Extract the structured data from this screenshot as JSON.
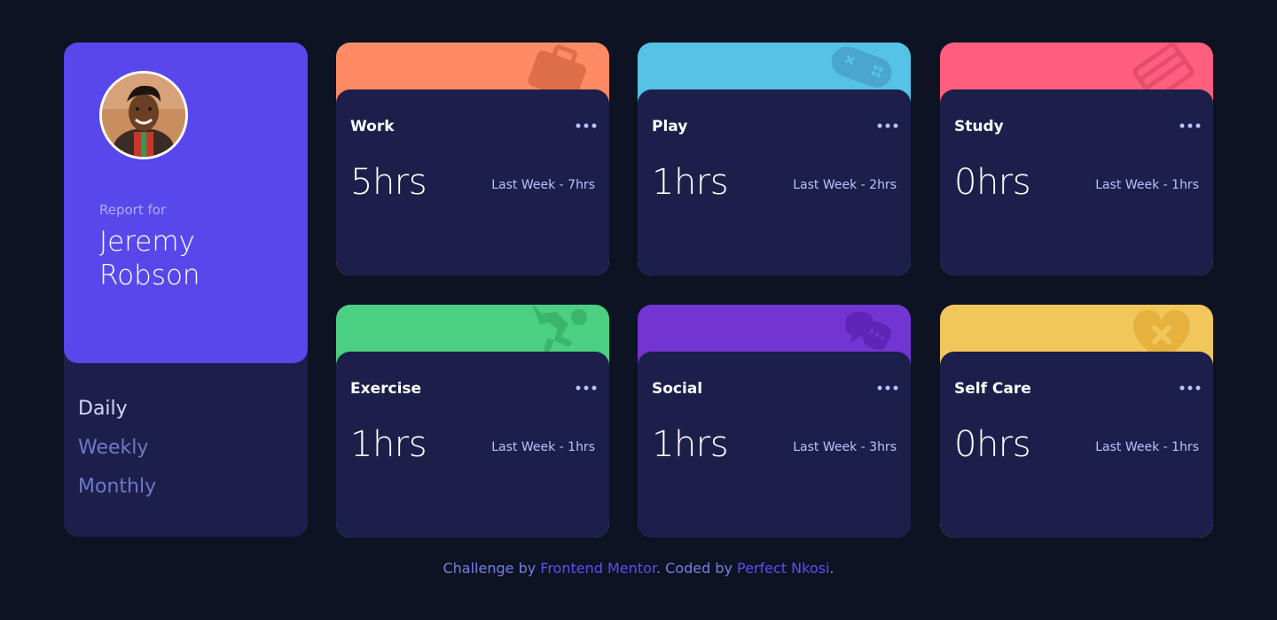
{
  "profile": {
    "report_label": "Report for",
    "name": "Jeremy Robson",
    "avatar_alt": "avatar"
  },
  "periods": [
    {
      "label": "Daily",
      "active": true
    },
    {
      "label": "Weekly",
      "active": false
    },
    {
      "label": "Monthly",
      "active": false
    }
  ],
  "cards": [
    {
      "title": "Work",
      "hours": "5hrs",
      "last_week": "Last Week - 7hrs",
      "color": "#ff8b64",
      "icon": "briefcase-icon"
    },
    {
      "title": "Play",
      "hours": "1hrs",
      "last_week": "Last Week - 2hrs",
      "color": "#55c2e6",
      "icon": "gamepad-icon"
    },
    {
      "title": "Study",
      "hours": "0hrs",
      "last_week": "Last Week - 1hrs",
      "color": "#ff5e7d",
      "icon": "books-icon"
    },
    {
      "title": "Exercise",
      "hours": "1hrs",
      "last_week": "Last Week - 1hrs",
      "color": "#4bcf82",
      "icon": "runner-icon"
    },
    {
      "title": "Social",
      "hours": "1hrs",
      "last_week": "Last Week - 3hrs",
      "color": "#7335d2",
      "icon": "chat-bubbles-icon"
    },
    {
      "title": "Self Care",
      "hours": "0hrs",
      "last_week": "Last Week - 1hrs",
      "color": "#f1c75b",
      "icon": "heart-icon"
    }
  ],
  "attribution": {
    "prefix": "Challenge by ",
    "link1": "Frontend Mentor",
    "middle": ". Coded by ",
    "link2": "Perfect Nkosi",
    "suffix": "."
  }
}
